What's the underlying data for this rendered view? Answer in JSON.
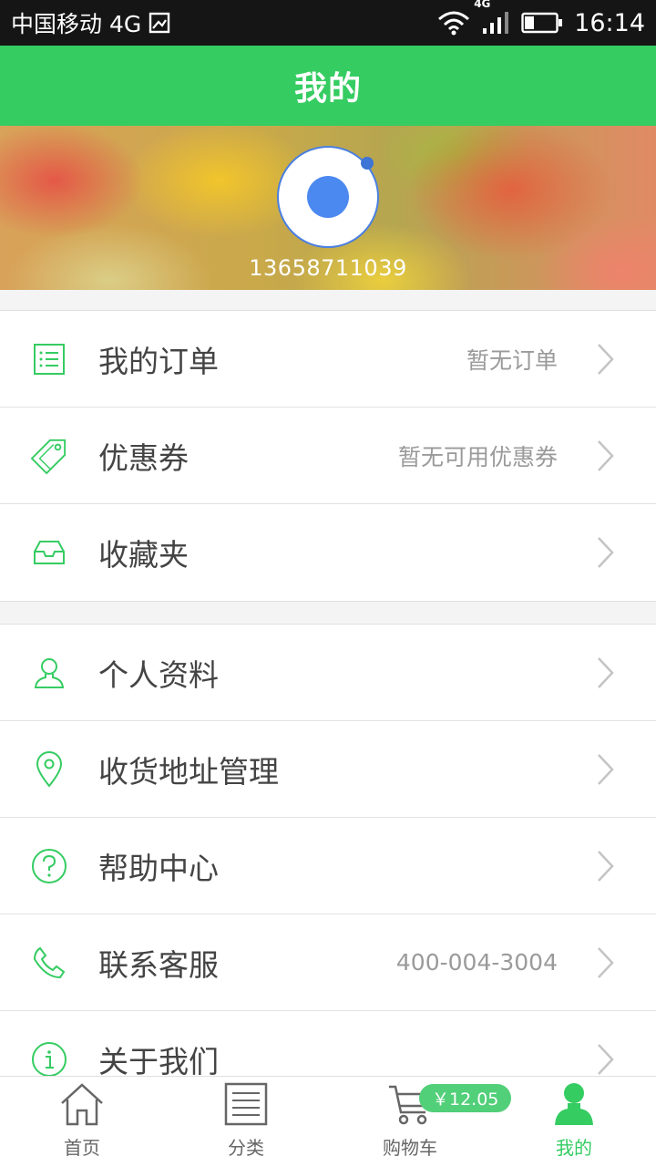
{
  "status_bar": {
    "carrier": "中国移动 4G",
    "network_badge": "4G",
    "time": "16:14"
  },
  "header": {
    "title": "我的"
  },
  "profile": {
    "phone": "13658711039"
  },
  "menu_group_1": [
    {
      "icon": "order-list-icon",
      "label": "我的订单",
      "value": "暂无订单"
    },
    {
      "icon": "coupon-tag-icon",
      "label": "优惠券",
      "value": "暂无可用优惠券"
    },
    {
      "icon": "favorites-inbox-icon",
      "label": "收藏夹",
      "value": ""
    }
  ],
  "menu_group_2": [
    {
      "icon": "user-icon",
      "label": "个人资料",
      "value": ""
    },
    {
      "icon": "location-pin-icon",
      "label": "收货地址管理",
      "value": ""
    },
    {
      "icon": "help-icon",
      "label": "帮助中心",
      "value": ""
    },
    {
      "icon": "phone-icon",
      "label": "联系客服",
      "value": "400-004-3004"
    },
    {
      "icon": "info-icon",
      "label": "关于我们",
      "value": ""
    }
  ],
  "tabbar": {
    "tabs": [
      {
        "icon": "home-icon",
        "label": "首页"
      },
      {
        "icon": "category-list-icon",
        "label": "分类"
      },
      {
        "icon": "cart-icon",
        "label": "购物车"
      },
      {
        "icon": "profile-icon",
        "label": "我的"
      }
    ],
    "cart_badge": "￥12.05",
    "active_index": 3
  },
  "colors": {
    "accent": "#35cc62",
    "text": "#444444",
    "muted": "#9a9a9a"
  }
}
